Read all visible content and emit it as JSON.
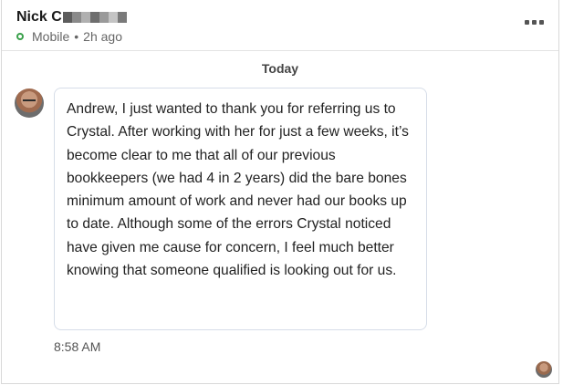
{
  "header": {
    "name": "Nick C",
    "redaction_colors": [
      "#5c5c5c",
      "#8a8a8a",
      "#b0b0b0",
      "#6e6e6e",
      "#9a9a9a",
      "#c4c4c4",
      "#7a7a7a"
    ],
    "status_device": "Mobile",
    "status_separator": "•",
    "status_time": "2h ago",
    "online_color": "#3aa14b",
    "more_icon": "more-horizontal-icon"
  },
  "conversation": {
    "date_label": "Today",
    "messages": [
      {
        "text": "Andrew, I just wanted to thank you for referring us to Crystal. After working with her for just a few weeks, it’s become clear to me that all of our previous bookkeepers (we had 4 in 2 years) did the bare bones minimum amount of work and never had our books up to date. Although some of the errors Crystal noticed have given me cause for concern, I feel much better knowing that someone qualified is looking out for us.",
        "time": "8:58 AM",
        "avatar_icon": "avatar-photo"
      }
    ],
    "seen_icon": "seen-avatar"
  }
}
